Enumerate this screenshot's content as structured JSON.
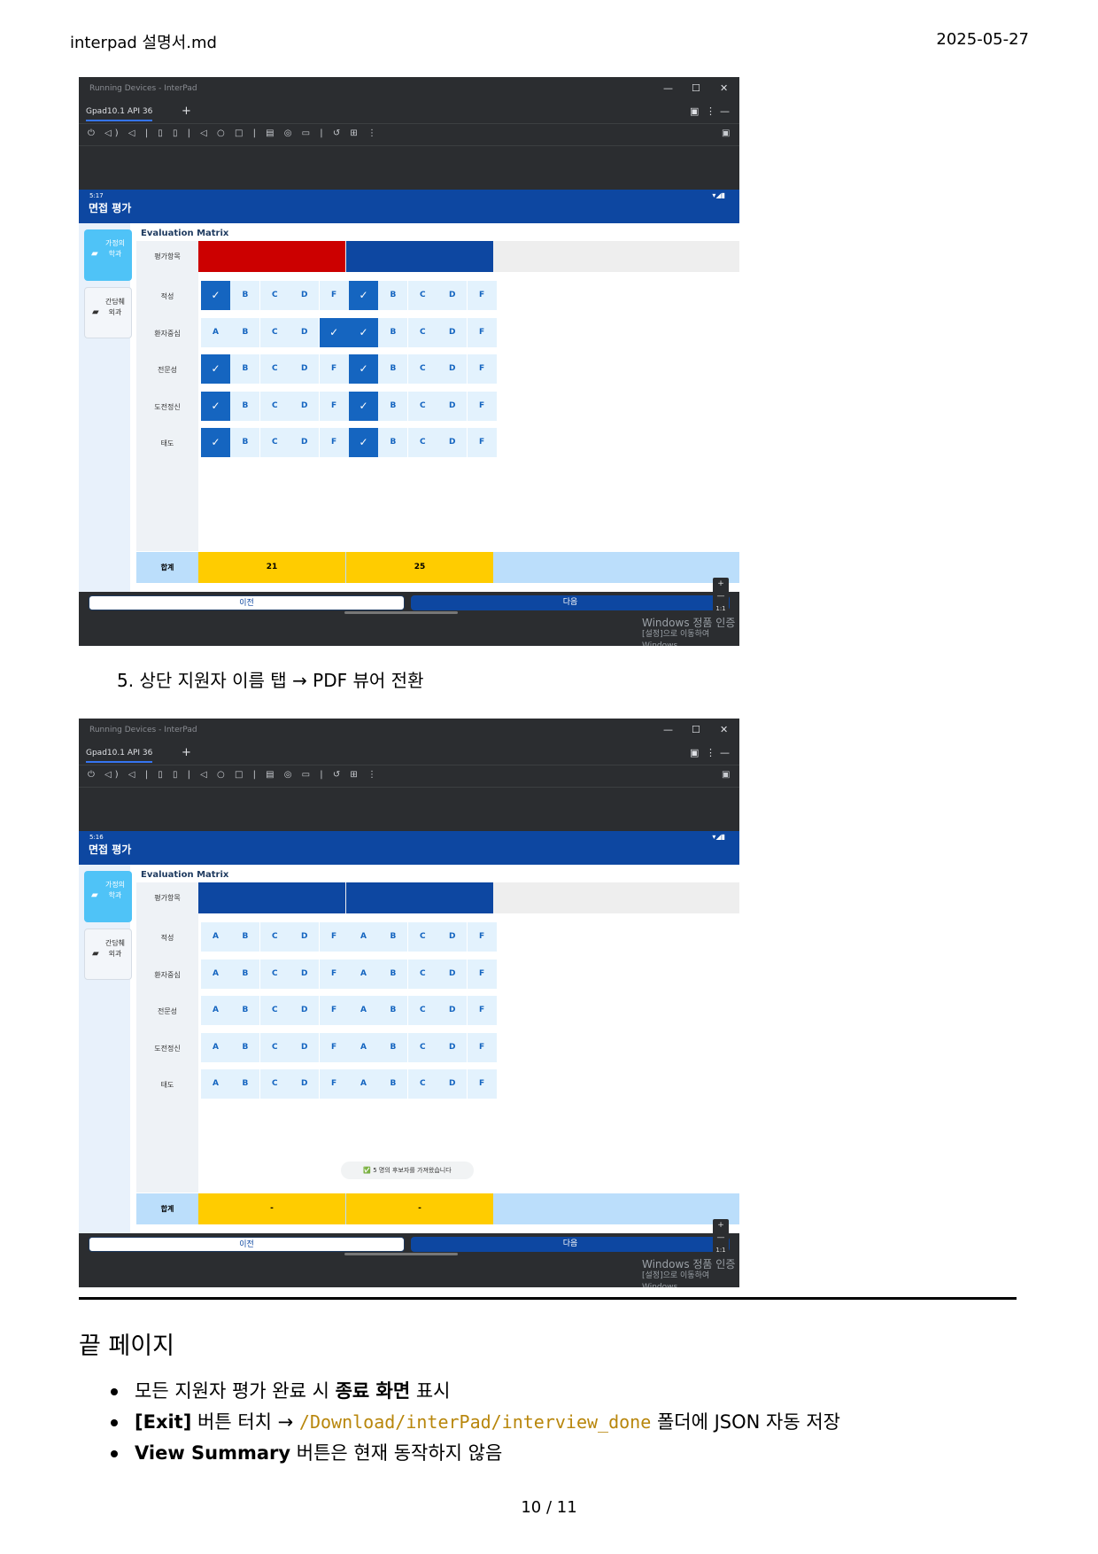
{
  "header": {
    "filename": "interpad 설명서.md",
    "date": "2025-05-27"
  },
  "screenshots": [
    {
      "window_title": "Running Devices - InterPad",
      "device_tab": "Gpad10.1 API 36",
      "window_controls": [
        "—",
        "☐",
        "✕"
      ],
      "status_time": "5:17",
      "app_title": "면접 평가",
      "side_cards": [
        "가정의학과",
        "간담췌외과"
      ],
      "matrix_title": "Evaluation Matrix",
      "header_label": "평가항목",
      "candidate_colors": [
        "#cc0000",
        "#0d47a1"
      ],
      "rows": [
        {
          "label": "적성",
          "selected": [
            "A",
            "A"
          ]
        },
        {
          "label": "환자중심",
          "selected": [
            "F",
            "A"
          ]
        },
        {
          "label": "전문성",
          "selected": [
            "A",
            "A"
          ]
        },
        {
          "label": "도전정신",
          "selected": [
            "A",
            "A"
          ]
        },
        {
          "label": "태도",
          "selected": [
            "A",
            "A"
          ]
        }
      ],
      "grades": [
        "A",
        "B",
        "C",
        "D",
        "F"
      ],
      "sum_label": "합계",
      "sums": [
        "21",
        "25"
      ],
      "prev_label": "이전",
      "next_label": "다음",
      "zoom_label": "1:1",
      "windows_watermark": [
        "Windows 정품 인증",
        "[설정]으로 이동하여 Windows"
      ]
    },
    {
      "window_title": "Running Devices - InterPad",
      "device_tab": "Gpad10.1 API 36",
      "window_controls": [
        "—",
        "☐",
        "✕"
      ],
      "status_time": "5:16",
      "app_title": "면접 평가",
      "side_cards": [
        "가정의학과",
        "간담췌외과"
      ],
      "matrix_title": "Evaluation Matrix",
      "header_label": "평가항목",
      "candidate_colors": [
        "#0d47a1",
        "#0d47a1"
      ],
      "rows": [
        {
          "label": "적성",
          "selected": [
            null,
            null
          ]
        },
        {
          "label": "환자중심",
          "selected": [
            null,
            null
          ]
        },
        {
          "label": "전문성",
          "selected": [
            null,
            null
          ]
        },
        {
          "label": "도전정신",
          "selected": [
            null,
            null
          ]
        },
        {
          "label": "태도",
          "selected": [
            null,
            null
          ]
        }
      ],
      "grades": [
        "A",
        "B",
        "C",
        "D",
        "F"
      ],
      "sum_label": "합계",
      "sums": [
        "-",
        "-"
      ],
      "prev_label": "이전",
      "next_label": "다음",
      "zoom_label": "1:1",
      "toast": "✅ 5 명의 후보자를 가져왔습니다",
      "windows_watermark": [
        "Windows 정품 인증",
        "[설정]으로 이동하여 Windows"
      ]
    }
  ],
  "step5": "5. 상단 지원자 이름 탭 → PDF 뷰어 전환",
  "end_page": {
    "heading": "끝 페이지",
    "bullets": [
      {
        "pre": "모든 지원자 평가 완료 시 ",
        "bold": "종료 화면",
        "post": " 표시"
      },
      {
        "pre": "",
        "bold": "[Exit]",
        "mid": " 버튼 터치 → ",
        "code": "/Download/interPad/interview_done",
        "post": " 폴더에 JSON 자동 저장"
      },
      {
        "pre": "",
        "bold": "View Summary",
        "post": " 버튼은 현재 동작하지 않음"
      }
    ]
  },
  "page_number": "10 / 11"
}
